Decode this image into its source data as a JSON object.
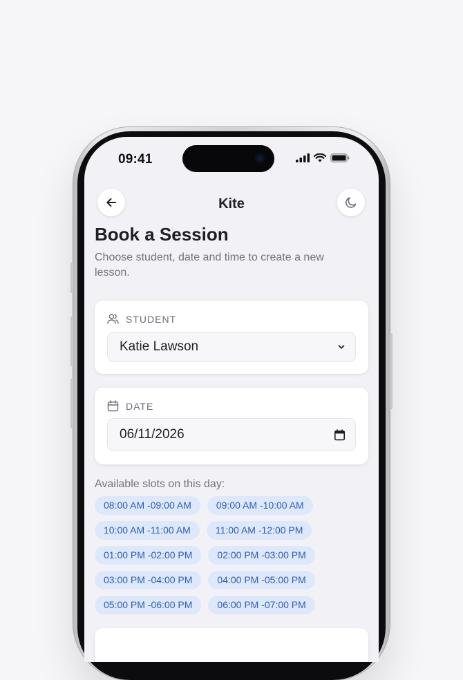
{
  "status_bar": {
    "time": "09:41"
  },
  "header": {
    "title": "Kite"
  },
  "page": {
    "heading": "Book a Session",
    "subtitle": "Choose student, date and time to create a new lesson."
  },
  "student": {
    "label": "STUDENT",
    "value": "Katie Lawson"
  },
  "date": {
    "label": "DATE",
    "value": "06/11/2026"
  },
  "slots": {
    "label": "Available slots on this day:",
    "items": [
      "08:00 AM -09:00 AM",
      "09:00 AM -10:00 AM",
      "10:00 AM -11:00 AM",
      "11:00 AM -12:00 PM",
      "01:00 PM -02:00 PM",
      "02:00 PM -03:00 PM",
      "03:00 PM -04:00 PM",
      "04:00 PM -05:00 PM",
      "05:00 PM -06:00 PM",
      "06:00 PM -07:00 PM"
    ]
  },
  "icons": {
    "back": "arrow-left-icon",
    "theme": "moon-icon",
    "student": "users-icon",
    "date": "calendar-icon",
    "dropdown": "chevron-down-icon",
    "date_picker": "calendar-picker-icon"
  },
  "colors": {
    "slot_bg": "#dde8fb",
    "slot_text": "#2e5bb8",
    "screen_bg": "#f2f2f6"
  }
}
